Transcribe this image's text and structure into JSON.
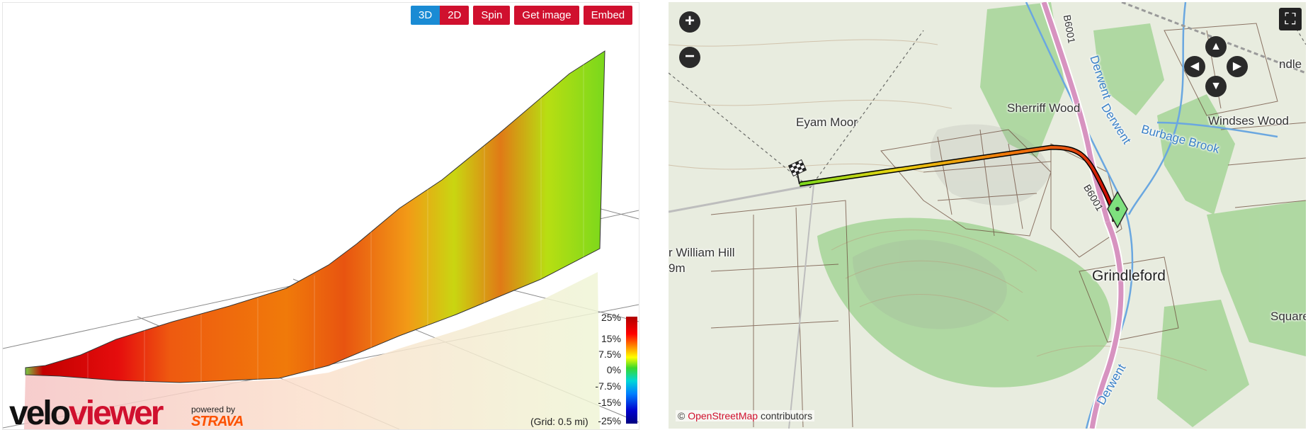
{
  "profile": {
    "toolbar": {
      "btn_3d": "3D",
      "btn_2d": "2D",
      "spin": "Spin",
      "get_image": "Get image",
      "embed": "Embed"
    },
    "legend": {
      "labels": [
        "25%",
        "15%",
        "7.5%",
        "0%",
        "-7.5%",
        "-15%",
        "-25%"
      ]
    },
    "grid_note": "(Grid: 0.5 mi)",
    "logo": {
      "part1": "velo",
      "part2": "viewer"
    },
    "powered_by": "powered by",
    "strava": "STRAVA"
  },
  "map": {
    "labels": {
      "eyam_moor": "Eyam Moor",
      "sherriff_wood": "Sherriff Wood",
      "derwent_1": "Derwent",
      "derwent_2": "Derwent",
      "derwent_3": "Derwent",
      "burbage_brook": "Burbage Brook",
      "windses_wood": "Windses Wood",
      "william_hill": "r William Hill",
      "height": "9m",
      "grindleford": "Grindleford",
      "square_wood": "Square Wo",
      "b6001_top": "B6001",
      "b6001_mid": "B6001",
      "town_top": "ndle"
    },
    "zoom_in": "+",
    "zoom_out": "−",
    "fullscreen": "⛶",
    "attribution": {
      "prefix": "©",
      "osm": "OpenStreetMap",
      "suffix": "contributors"
    }
  },
  "colors": {
    "accent_red": "#d0102e",
    "accent_blue": "#1a8bd4",
    "strava_orange": "#fc5200",
    "woodland": "#a7d59a",
    "road_pink": "#d793c0"
  }
}
